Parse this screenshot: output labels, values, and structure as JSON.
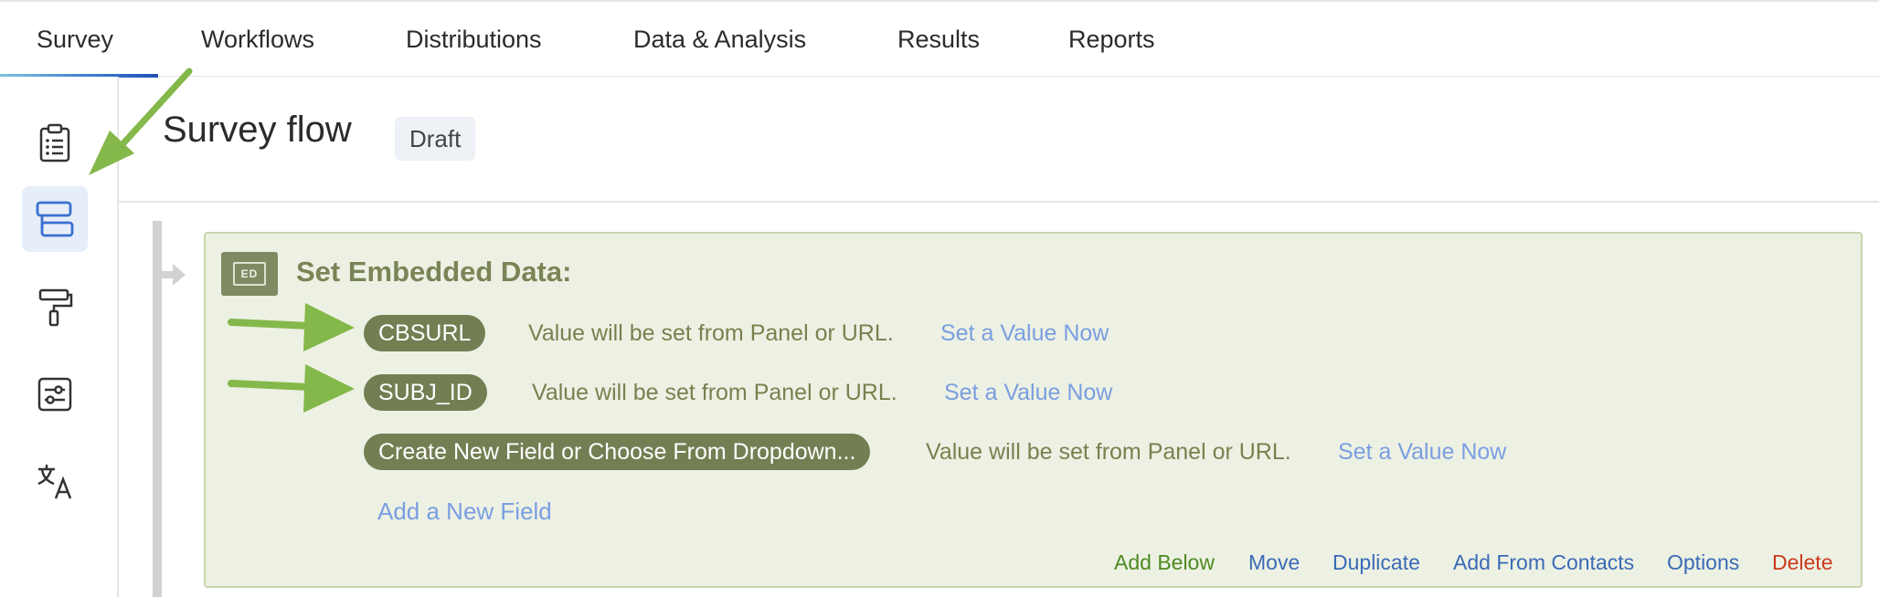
{
  "nav": {
    "tabs": [
      {
        "label": "Survey",
        "active": true
      },
      {
        "label": "Workflows"
      },
      {
        "label": "Distributions"
      },
      {
        "label": "Data & Analysis"
      },
      {
        "label": "Results"
      },
      {
        "label": "Reports"
      }
    ]
  },
  "sidebar": {
    "items": [
      {
        "icon": "clipboard-icon"
      },
      {
        "icon": "survey-flow-icon",
        "active": true
      },
      {
        "icon": "paint-roller-icon"
      },
      {
        "icon": "survey-options-icon"
      },
      {
        "icon": "translate-icon"
      }
    ]
  },
  "page": {
    "title": "Survey flow",
    "status_badge": "Draft"
  },
  "embedded_data": {
    "icon_label": "ED",
    "title": "Set Embedded Data:",
    "fields": [
      {
        "name": "CBSURL",
        "value_text": "Value will be set from Panel or URL.",
        "set_value_link": "Set a Value Now"
      },
      {
        "name": "SUBJ_ID",
        "value_text": "Value will be set from Panel or URL.",
        "set_value_link": "Set a Value Now"
      },
      {
        "name": "Create New Field or Choose From Dropdown...",
        "value_text": "Value will be set from Panel or URL.",
        "set_value_link": "Set a Value Now"
      }
    ],
    "add_field_link": "Add a New Field",
    "actions": {
      "add_below": "Add Below",
      "move": "Move",
      "duplicate": "Duplicate",
      "add_from_contacts": "Add From Contacts",
      "options": "Options",
      "delete": "Delete"
    }
  },
  "colors": {
    "accent_blue": "#2352b8",
    "annotation_arrow": "#84b84a",
    "block_background": "#edf1e4",
    "pill_background": "#737e53",
    "link_blue": "#7a9ee0",
    "delete_red": "#cc3a1e"
  }
}
